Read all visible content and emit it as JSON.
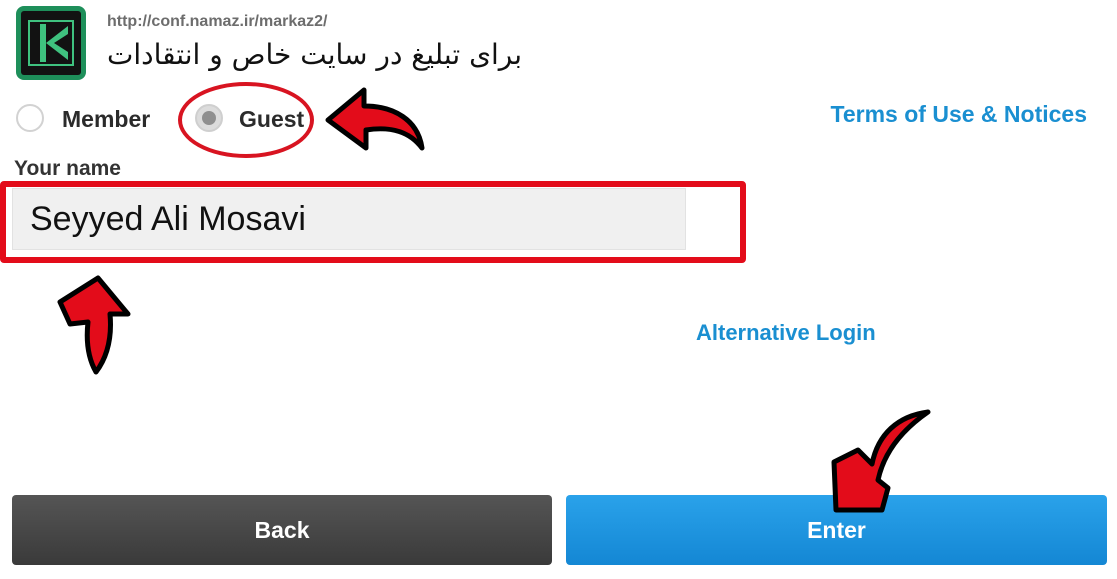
{
  "header": {
    "logo_icon": "adobe-connect-app-icon",
    "url": "http://conf.namaz.ir/markaz2/",
    "title": "برای تبلیغ در سایت خاص و انتقادات"
  },
  "login_type": {
    "selected": "Guest",
    "options": [
      {
        "label": "Member",
        "checked": false
      },
      {
        "label": "Guest",
        "checked": true
      }
    ]
  },
  "links": {
    "terms": "Terms of Use & Notices",
    "alternative_login": "Alternative Login"
  },
  "name_field": {
    "label": "Your name",
    "value": "Seyyed Ali Mosavi"
  },
  "buttons": {
    "back": "Back",
    "enter": "Enter"
  },
  "annotations": {
    "color": "#e30c1a",
    "marks": [
      "arrow-icon",
      "arrow-icon",
      "arrow-icon",
      "highlight-oval",
      "highlight-frame"
    ]
  }
}
